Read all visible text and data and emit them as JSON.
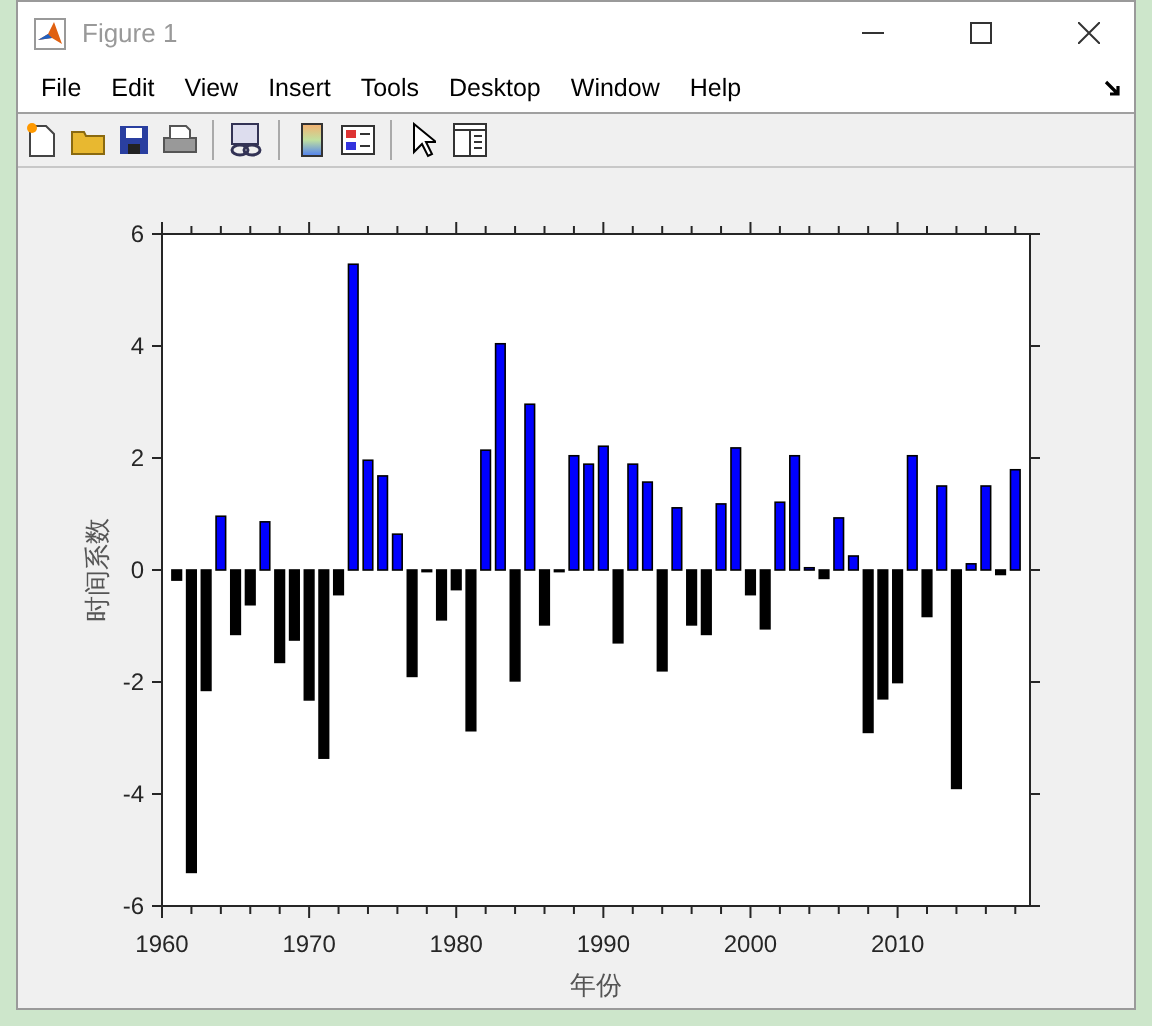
{
  "window": {
    "title": "Figure 1"
  },
  "menu": [
    "File",
    "Edit",
    "View",
    "Insert",
    "Tools",
    "Desktop",
    "Window",
    "Help"
  ],
  "toolbar": [
    {
      "kind": "new"
    },
    {
      "kind": "open"
    },
    {
      "kind": "save"
    },
    {
      "kind": "print"
    },
    {
      "kind": "separator"
    },
    {
      "kind": "link"
    },
    {
      "kind": "separator"
    },
    {
      "kind": "colorbar"
    },
    {
      "kind": "legend"
    },
    {
      "kind": "separator"
    },
    {
      "kind": "pointer"
    },
    {
      "kind": "panel"
    }
  ],
  "figure": {
    "chart_data": {
      "type": "bar",
      "xlabel": "年份",
      "ylabel": "时间系数",
      "xlim": [
        1960,
        2019
      ],
      "ylim": [
        -6,
        6
      ],
      "xticks": [
        1960,
        1970,
        1980,
        1990,
        2000,
        2010
      ],
      "yticks": [
        -6,
        -4,
        -2,
        0,
        2,
        4,
        6
      ],
      "x": [
        1961,
        1962,
        1963,
        1964,
        1965,
        1966,
        1967,
        1968,
        1969,
        1970,
        1971,
        1972,
        1973,
        1974,
        1975,
        1976,
        1977,
        1978,
        1979,
        1980,
        1981,
        1982,
        1983,
        1984,
        1985,
        1986,
        1987,
        1988,
        1989,
        1990,
        1991,
        1992,
        1993,
        1994,
        1995,
        1996,
        1997,
        1998,
        1999,
        2000,
        2001,
        2002,
        2003,
        2004,
        2005,
        2006,
        2007,
        2008,
        2009,
        2010,
        2011,
        2012,
        2013,
        2014,
        2015,
        2016,
        2017,
        2018
      ],
      "series": [
        {
          "color": "#0000ff",
          "values": [
            null,
            null,
            null,
            0.96,
            null,
            null,
            0.86,
            null,
            null,
            null,
            null,
            null,
            5.46,
            1.96,
            1.68,
            0.64,
            null,
            0,
            null,
            null,
            null,
            2.14,
            4.04,
            null,
            2.96,
            null,
            0,
            2.04,
            1.89,
            2.21,
            null,
            1.89,
            1.57,
            null,
            1.11,
            null,
            null,
            1.18,
            2.18,
            null,
            null,
            1.21,
            2.04,
            0.04,
            null,
            0.93,
            0.25,
            null,
            null,
            null,
            2.04,
            null,
            1.5,
            null,
            0.11,
            1.5,
            null,
            1.79
          ]
        },
        {
          "color": "#000000",
          "values": [
            -0.18,
            -5.4,
            -2.15,
            null,
            -1.15,
            -0.62,
            null,
            -1.65,
            -1.25,
            -2.32,
            -3.36,
            -0.44,
            null,
            null,
            null,
            null,
            -1.9,
            null,
            -0.89,
            -0.35,
            -2.87,
            null,
            null,
            -1.98,
            null,
            -0.98,
            null,
            null,
            null,
            null,
            -1.3,
            null,
            null,
            -1.8,
            null,
            -0.98,
            -1.15,
            null,
            null,
            -0.44,
            -1.05,
            null,
            null,
            null,
            -0.15,
            null,
            null,
            -2.9,
            -2.3,
            -2.01,
            null,
            -0.83,
            null,
            -3.9,
            null,
            null,
            -0.08,
            null
          ]
        }
      ]
    }
  }
}
